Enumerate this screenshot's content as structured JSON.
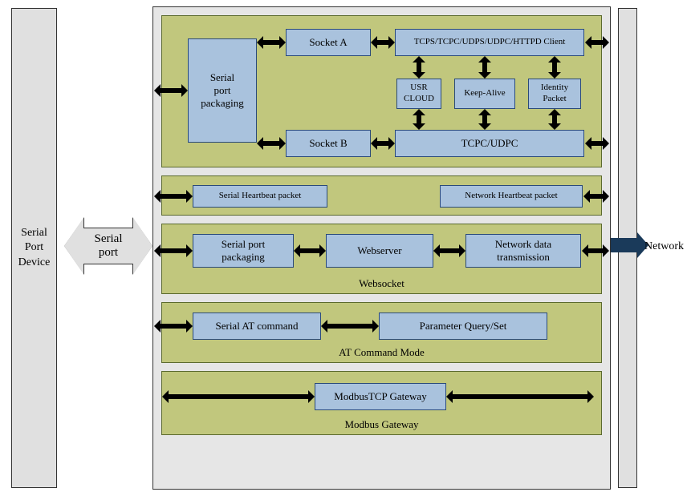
{
  "left_panel": {
    "label": "Serial\nPort\nDevice"
  },
  "serial_port_arrow": {
    "label": "Serial\nport"
  },
  "right_panel": {
    "label": "Network"
  },
  "modules": {
    "transparent": {
      "serial_port_packaging": "Serial\nport\npackaging",
      "socket_a": "Socket A",
      "socket_b": "Socket B",
      "protocols": "TCPS/TCPC/UDPS/UDPC/HTTPD Client",
      "usr_cloud": "USR\nCLOUD",
      "keep_alive": "Keep-Alive",
      "identity_packet": "Identity\nPacket",
      "tcpc_udpc": "TCPC/UDPC"
    },
    "heartbeat": {
      "serial_hb": "Serial Heartbeat packet",
      "network_hb": "Network Heartbeat packet"
    },
    "websocket": {
      "caption": "Websocket",
      "serial_port_packaging": "Serial port\npackaging",
      "webserver": "Webserver",
      "network_data": "Network data\ntransmission"
    },
    "at_cmd": {
      "caption": "AT Command Mode",
      "serial_at": "Serial AT command",
      "param_qs": "Parameter Query/Set"
    },
    "modbus": {
      "caption": "Modbus Gateway",
      "gateway": "ModbusTCP Gateway"
    }
  }
}
